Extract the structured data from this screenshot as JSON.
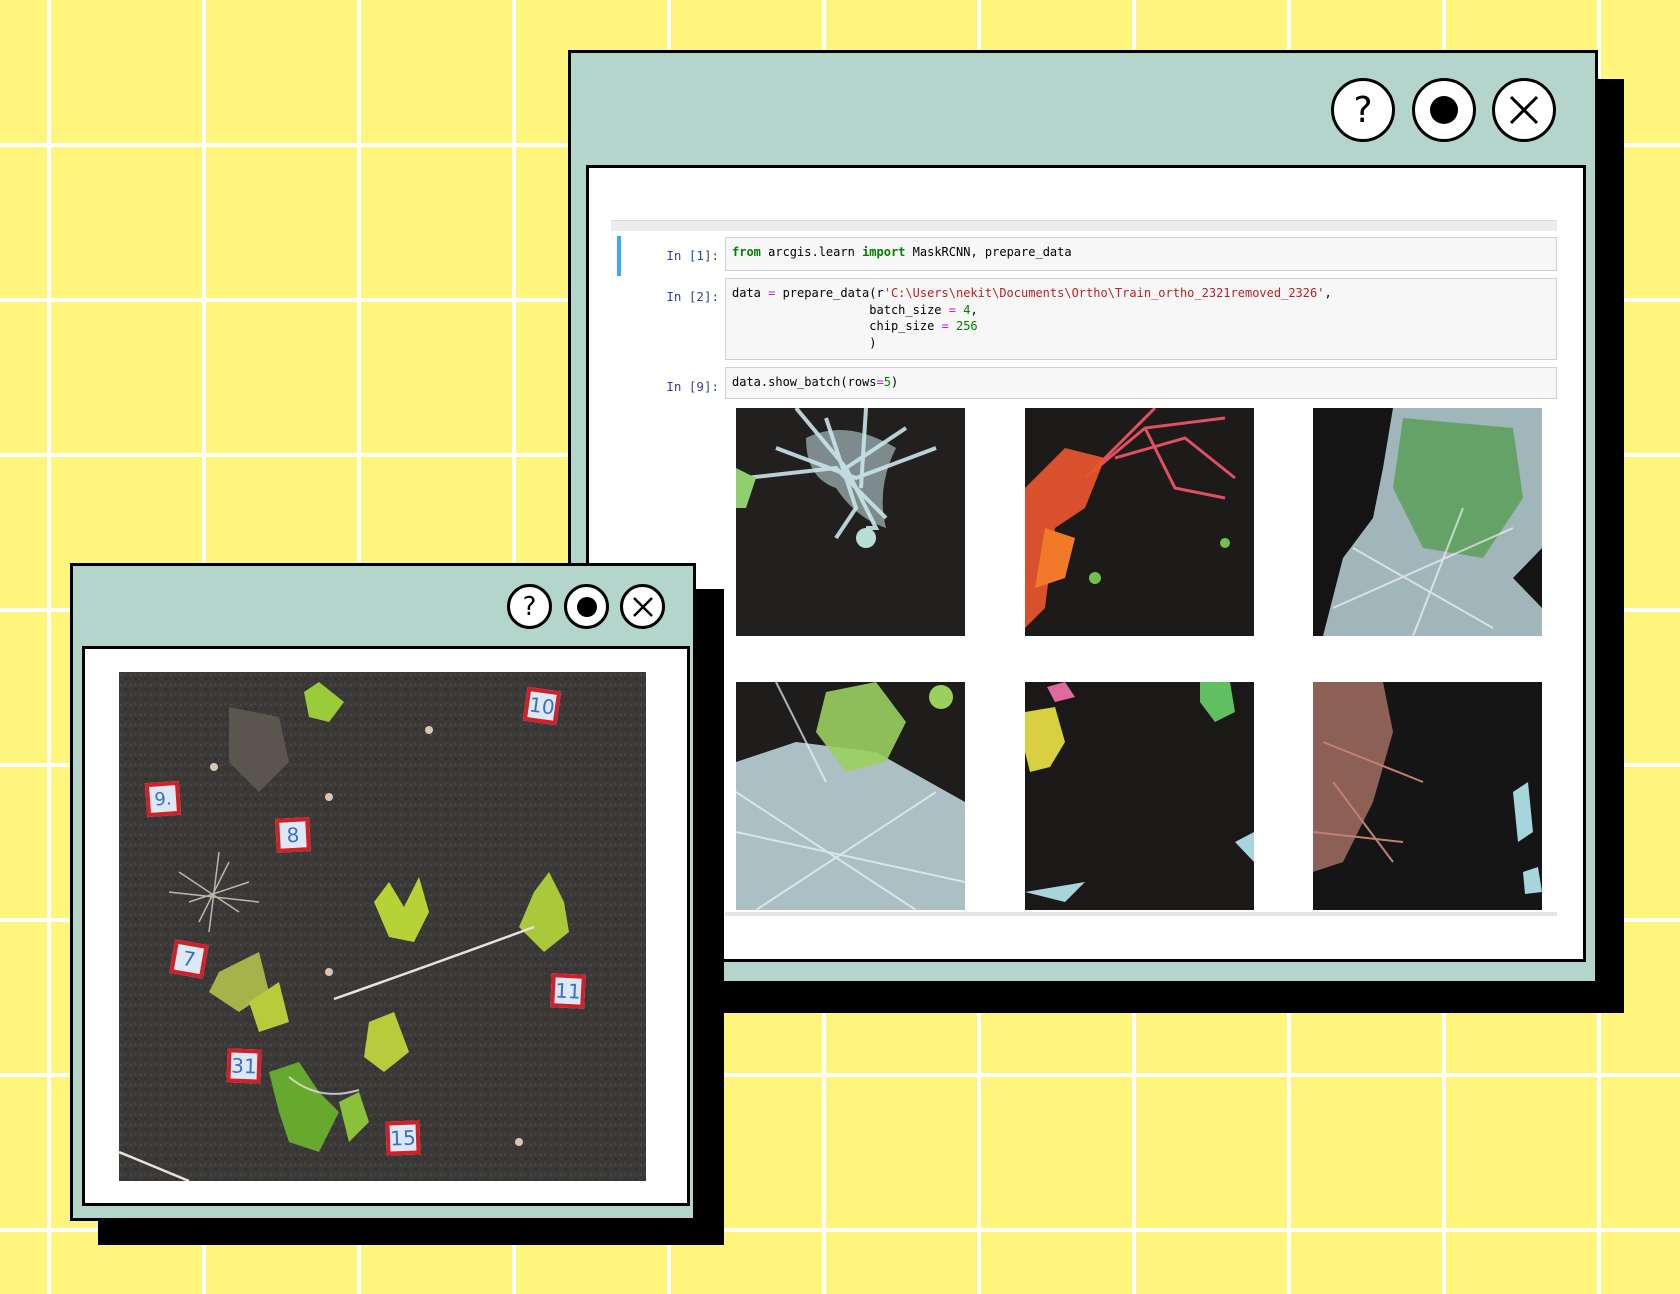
{
  "notebook_window": {
    "controls": {
      "help": "?",
      "record": "●",
      "close": "✕"
    },
    "cells": [
      {
        "prompt": "In [1]:",
        "code": [
          [
            {
              "t": "kw",
              "v": "from"
            },
            {
              "t": "pl",
              "v": " arcgis.learn "
            },
            {
              "t": "kw",
              "v": "import"
            },
            {
              "t": "pl",
              "v": " MaskRCNN, prepare_data"
            }
          ]
        ]
      },
      {
        "prompt": "In [2]:",
        "code": [
          [
            {
              "t": "pl",
              "v": "data "
            },
            {
              "t": "op",
              "v": "="
            },
            {
              "t": "pl",
              "v": " prepare_data(r"
            },
            {
              "t": "str",
              "v": "'C:\\Users\\nekit\\Documents\\Ortho\\Train_ortho_2321removed_2326'"
            },
            {
              "t": "pl",
              "v": ","
            }
          ],
          [
            {
              "t": "pl",
              "v": "                   batch_size "
            },
            {
              "t": "op",
              "v": "="
            },
            {
              "t": "pl",
              "v": " "
            },
            {
              "t": "num",
              "v": "4"
            },
            {
              "t": "pl",
              "v": ","
            }
          ],
          [
            {
              "t": "pl",
              "v": "                   chip_size "
            },
            {
              "t": "op",
              "v": "="
            },
            {
              "t": "pl",
              "v": " "
            },
            {
              "t": "num",
              "v": "256"
            }
          ],
          [
            {
              "t": "pl",
              "v": "                   )"
            }
          ]
        ]
      },
      {
        "prompt": "In [9]:",
        "code": [
          [
            {
              "t": "pl",
              "v": "data.show_batch(rows"
            },
            {
              "t": "op",
              "v": "="
            },
            {
              "t": "num",
              "v": "5"
            },
            {
              "t": "pl",
              "v": ")"
            }
          ]
        ]
      }
    ],
    "batch_images": [
      {
        "name": "batch-image-1",
        "mask_colors": [
          "#c9e4ea"
        ]
      },
      {
        "name": "batch-image-2",
        "mask_colors": [
          "#e8562e",
          "#e05060"
        ]
      },
      {
        "name": "batch-image-3",
        "mask_colors": [
          "#c9e4ea",
          "#5ea05e"
        ]
      },
      {
        "name": "batch-image-4",
        "mask_colors": [
          "#c9e4ea",
          "#9ad060"
        ]
      },
      {
        "name": "batch-image-5",
        "mask_colors": [
          "#d8d040",
          "#e06aa0",
          "#60c060"
        ]
      },
      {
        "name": "batch-image-6",
        "mask_colors": [
          "#c08070",
          "#a8d4dc"
        ]
      }
    ]
  },
  "photo_window": {
    "controls": {
      "help": "?",
      "record": "●",
      "close": "✕"
    },
    "plot_labels": [
      "10",
      "9.",
      "8",
      "7",
      "11",
      "31",
      "15"
    ]
  },
  "colors": {
    "background": "#fff57c",
    "window_frame": "#b3d5cc",
    "prompt": "#303f9f",
    "keyword": "#008000",
    "string": "#ba2121",
    "label_border": "#d0202a",
    "label_text": "#3a6ec8"
  }
}
